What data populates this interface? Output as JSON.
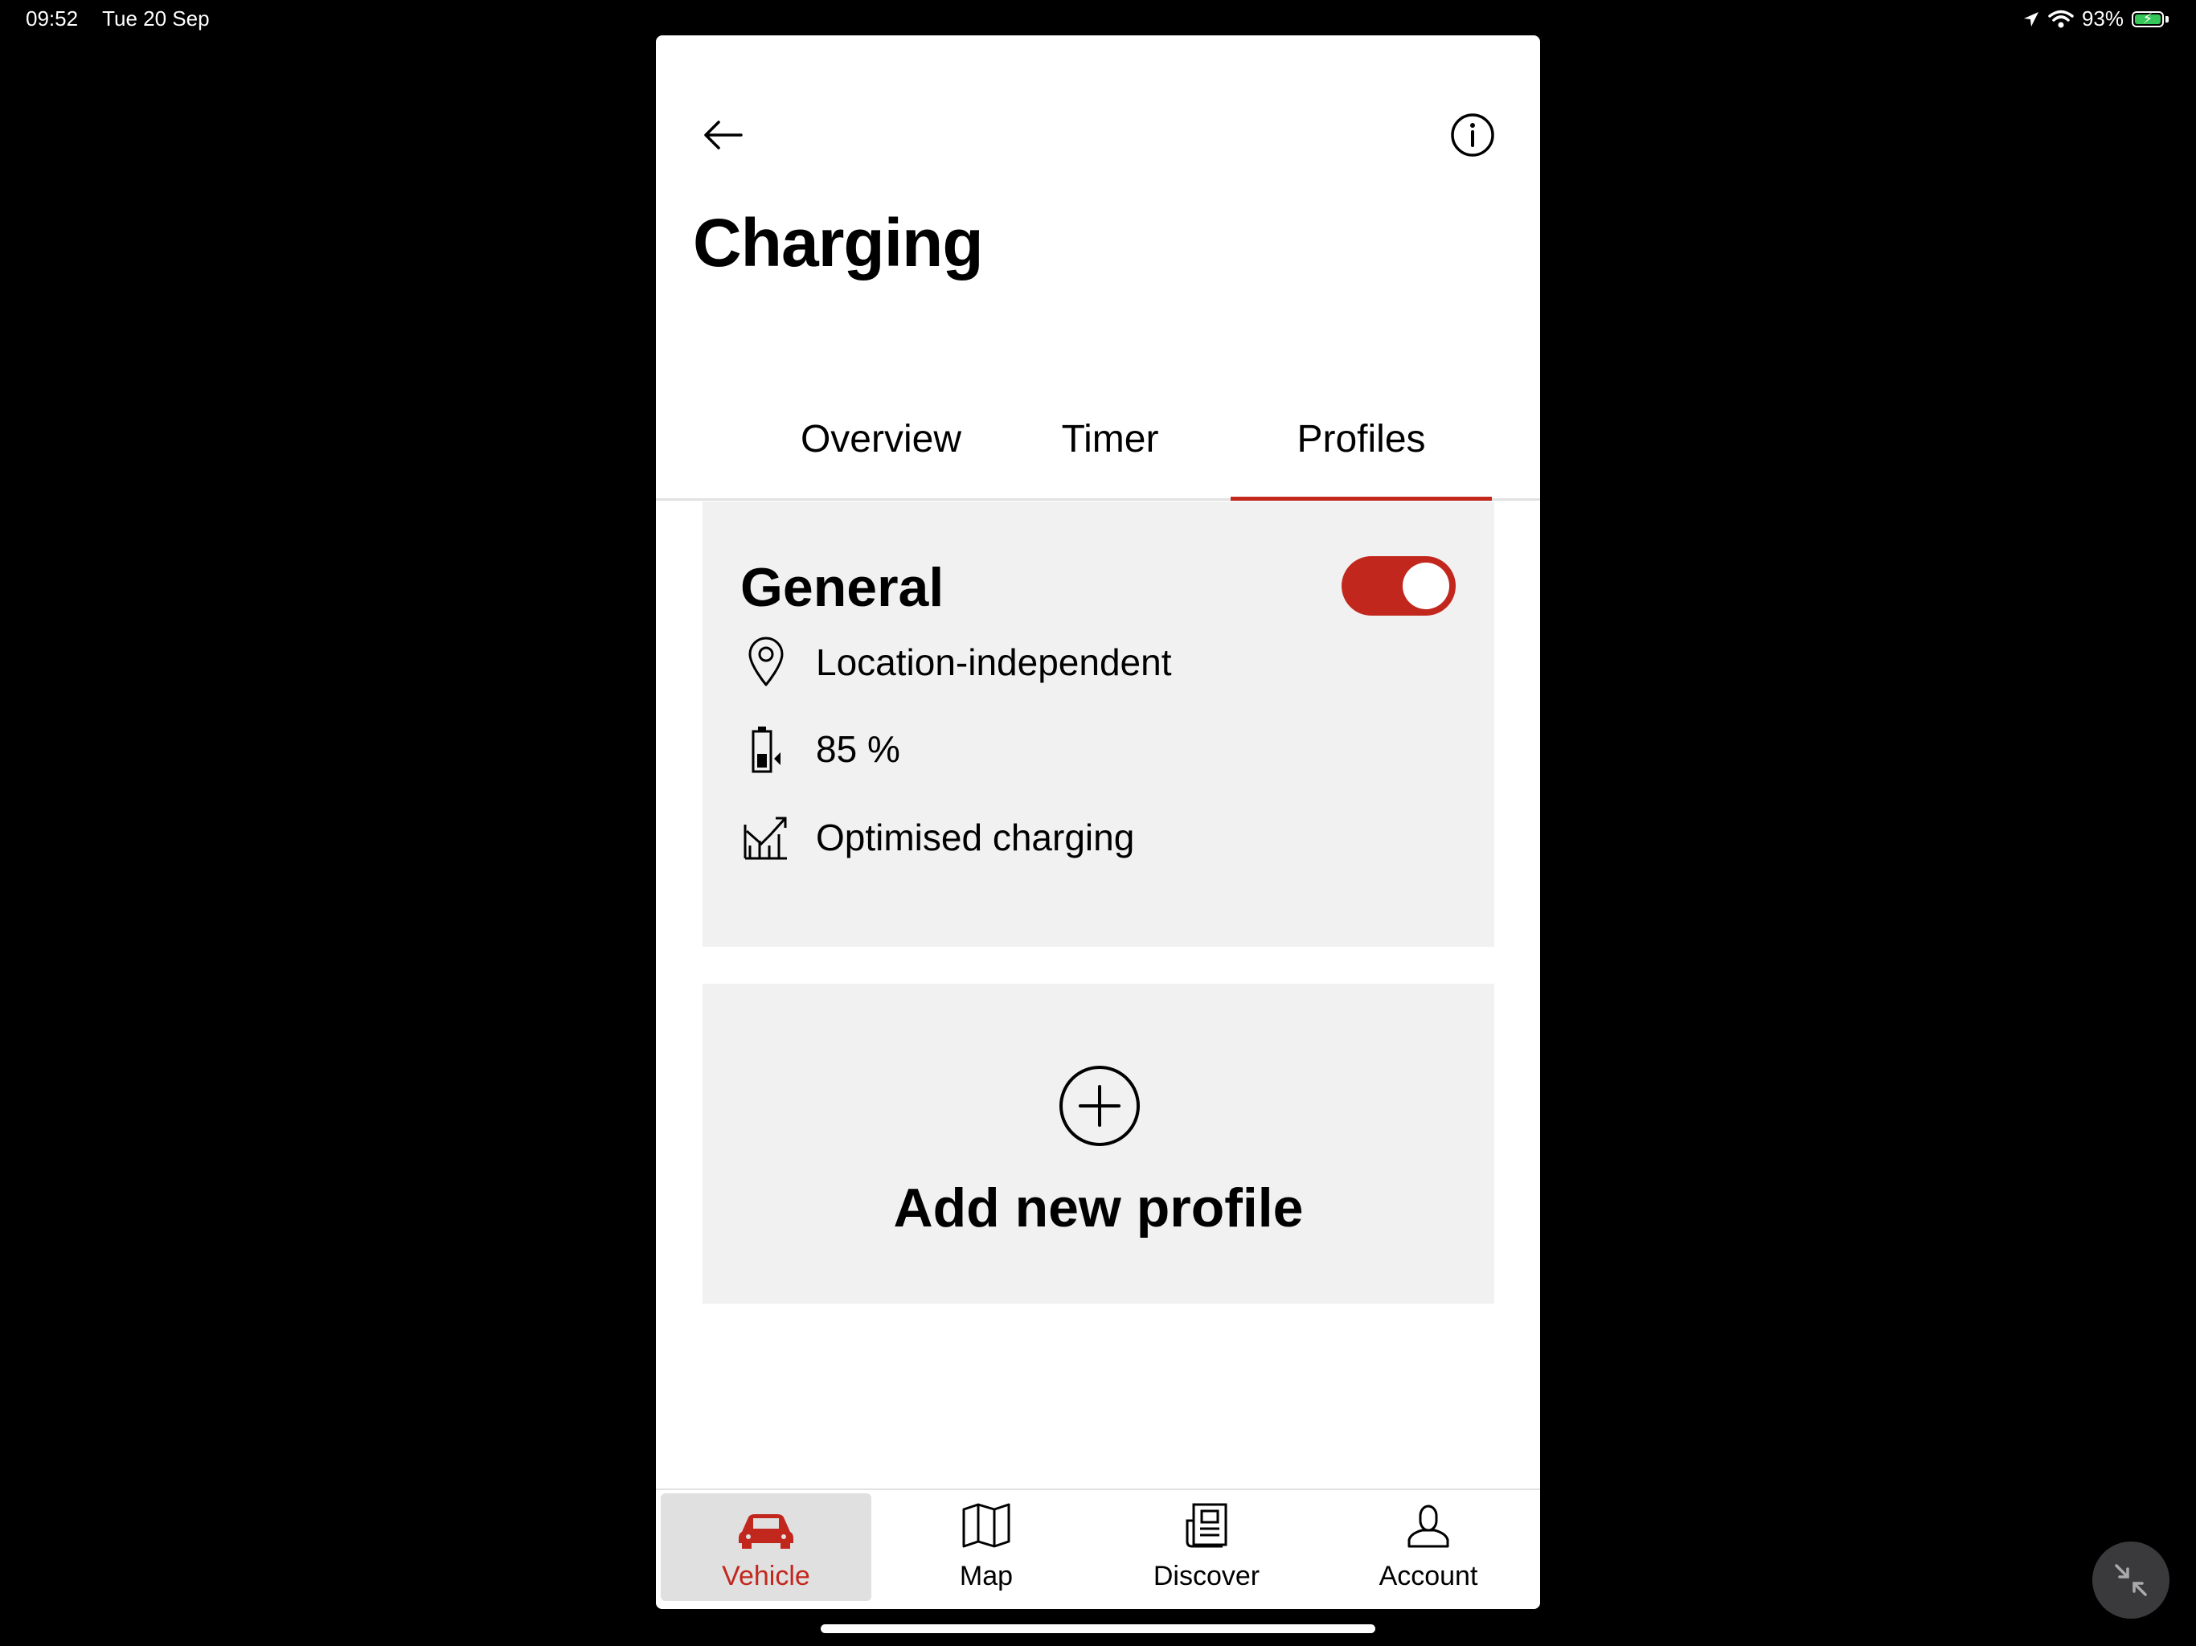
{
  "status_bar": {
    "time": "09:52",
    "date": "Tue 20 Sep",
    "battery_percent": "93%",
    "battery_level": 0.93
  },
  "header": {
    "title": "Charging"
  },
  "tabs": [
    {
      "label": "Overview",
      "active": false
    },
    {
      "label": "Timer",
      "active": false
    },
    {
      "label": "Profiles",
      "active": true
    }
  ],
  "profile": {
    "name": "General",
    "enabled": true,
    "location": "Location-independent",
    "target_charge": "85 %",
    "charging_mode": "Optimised charging"
  },
  "add_profile": {
    "label": "Add new profile"
  },
  "bottom_nav": [
    {
      "label": "Vehicle",
      "icon": "car-icon",
      "active": true
    },
    {
      "label": "Map",
      "icon": "map-icon",
      "active": false
    },
    {
      "label": "Discover",
      "icon": "news-icon",
      "active": false
    },
    {
      "label": "Account",
      "icon": "user-icon",
      "active": false
    }
  ],
  "colors": {
    "accent": "#c2271e",
    "card_background": "#f1f1f1",
    "page_background": "#000000"
  }
}
